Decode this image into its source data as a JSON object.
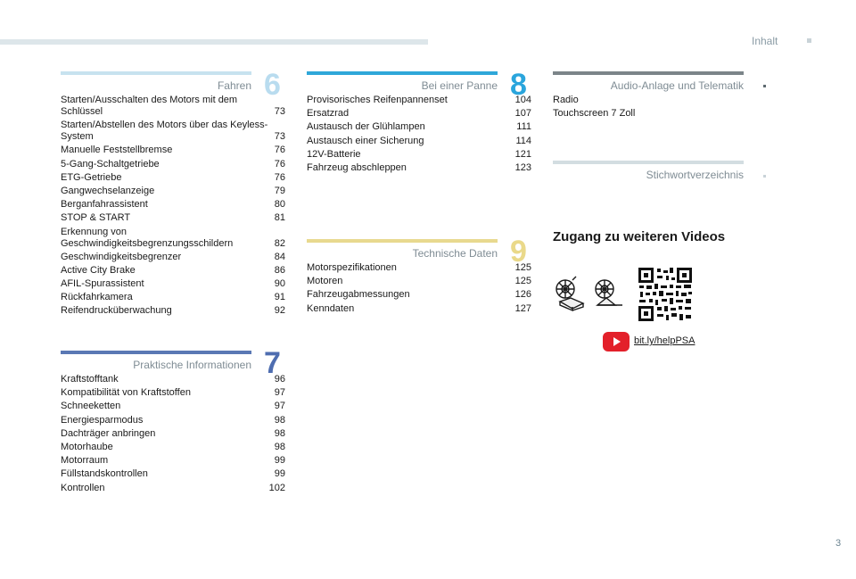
{
  "header": {
    "label": "Inhalt"
  },
  "sections": [
    {
      "title": "Fahren",
      "number": "6",
      "bar_color": "#c7e2ef",
      "num_color": "#b9dcef",
      "items": [
        {
          "title": "Starten/Ausschalten des Motors mit dem Schlüssel",
          "page": "73"
        },
        {
          "title": "Starten/Abstellen des Motors über das Keyless-System",
          "page": "73"
        },
        {
          "title": "Manuelle Feststellbremse",
          "page": "76"
        },
        {
          "title": "5-Gang-Schaltgetriebe",
          "page": "76"
        },
        {
          "title": "ETG-Getriebe",
          "page": "76"
        },
        {
          "title": "Gangwechselanzeige",
          "page": "79"
        },
        {
          "title": "Berganfahrassistent",
          "page": "80"
        },
        {
          "title": "STOP & START",
          "page": "81"
        },
        {
          "title": "Erkennung von Geschwindigkeitsbegrenzungsschildern",
          "page": "82"
        },
        {
          "title": "Geschwindigkeitsbegrenzer",
          "page": "84"
        },
        {
          "title": "Active City Brake",
          "page": "86"
        },
        {
          "title": "AFIL-Spurassistent",
          "page": "90"
        },
        {
          "title": "Rückfahrkamera",
          "page": "91"
        },
        {
          "title": "Reifendrucküberwachung",
          "page": "92"
        }
      ]
    },
    {
      "title": "Praktische Informationen",
      "number": "7",
      "bar_color": "#5a78b4",
      "num_color": "#4e6db0",
      "items": [
        {
          "title": "Kraftstofftank",
          "page": "96"
        },
        {
          "title": "Kompatibilität von Kraftstoffen",
          "page": "97"
        },
        {
          "title": "Schneeketten",
          "page": "97"
        },
        {
          "title": "Energiesparmodus",
          "page": "98"
        },
        {
          "title": "Dachträger anbringen",
          "page": "98"
        },
        {
          "title": "Motorhaube",
          "page": "98"
        },
        {
          "title": "Motorraum",
          "page": "99"
        },
        {
          "title": "Füllstandskontrollen",
          "page": "99"
        },
        {
          "title": "Kontrollen",
          "page": "102"
        }
      ]
    },
    {
      "title": "Bei einer Panne",
      "number": "8",
      "bar_color": "#2fa7d9",
      "num_color": "#2aa5dc",
      "items": [
        {
          "title": "Provisorisches Reifenpannenset",
          "page": "104"
        },
        {
          "title": "Ersatzrad",
          "page": "107"
        },
        {
          "title": "Austausch der Glühlampen",
          "page": "111"
        },
        {
          "title": "Austausch einer Sicherung",
          "page": "114"
        },
        {
          "title": "12V-Batterie",
          "page": "121"
        },
        {
          "title": "Fahrzeug abschleppen",
          "page": "123"
        }
      ]
    },
    {
      "title": "Technische Daten",
      "number": "9",
      "bar_color": "#e8d98f",
      "num_color": "#ead98a",
      "items": [
        {
          "title": "Motorspezifikationen",
          "page": "125"
        },
        {
          "title": "Motoren",
          "page": "125"
        },
        {
          "title": "Fahrzeugabmessungen",
          "page": "126"
        },
        {
          "title": "Kenndaten",
          "page": "127"
        }
      ]
    },
    {
      "title": "Audio-Anlage und Telematik",
      "bar_color": "#7c8589",
      "items": [
        {
          "title": "Radio",
          "page": ""
        },
        {
          "title": "Touchscreen 7 Zoll",
          "page": ""
        }
      ]
    },
    {
      "title": "Stichwortverzeichnis",
      "bar_color": "#d3dde1",
      "items": []
    }
  ],
  "videos": {
    "heading": "Zugang zu weiteren Videos",
    "link": "bit.ly/helpPSA",
    "yt_color": "#e3202a"
  },
  "page_number": "3"
}
